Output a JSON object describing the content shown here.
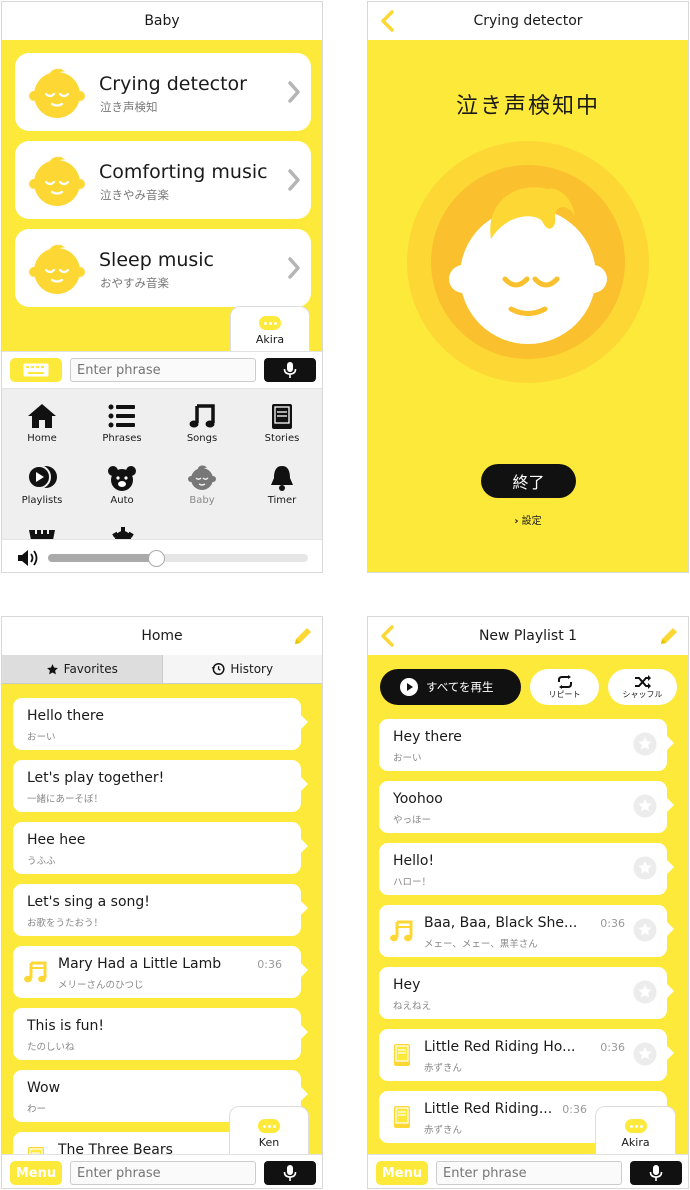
{
  "baby_screen": {
    "title": "Baby",
    "cards": [
      {
        "title": "Crying detector",
        "subtitle": "泣き声検知"
      },
      {
        "title": "Comforting music",
        "subtitle": "泣きやみ音楽"
      },
      {
        "title": "Sleep music",
        "subtitle": "おやすみ音楽"
      }
    ],
    "user_tab": "Akira",
    "phrase_placeholder": "Enter phrase",
    "menu": [
      {
        "label": "Home",
        "icon": "home-icon"
      },
      {
        "label": "Phrases",
        "icon": "list-icon"
      },
      {
        "label": "Songs",
        "icon": "music-note-icon"
      },
      {
        "label": "Stories",
        "icon": "book-icon"
      },
      {
        "label": "Playlists",
        "icon": "playlist-icon"
      },
      {
        "label": "Auto",
        "icon": "bear-icon"
      },
      {
        "label": "Baby",
        "icon": "baby-icon"
      },
      {
        "label": "Timer",
        "icon": "bell-icon"
      }
    ],
    "volume": 0.41
  },
  "crying_screen": {
    "title": "Crying detector",
    "status": "泣き声検知中",
    "end_button": "終了",
    "settings_link": "設定"
  },
  "home_screen": {
    "title": "Home",
    "tabs": [
      "Favorites",
      "History"
    ],
    "items": [
      {
        "main": "Hello there",
        "sub": "おーい"
      },
      {
        "main": "Let's play together!",
        "sub": "一緒にあーそぼ！"
      },
      {
        "main": "Hee hee",
        "sub": "うふふ"
      },
      {
        "main": "Let's sing a song!",
        "sub": "お歌をうたおう！"
      },
      {
        "main": "Mary Had a Little Lamb",
        "sub": "メリーさんのひつじ",
        "duration": "0:36"
      },
      {
        "main": "This is fun!",
        "sub": "たのしいね"
      },
      {
        "main": "Wow",
        "sub": "わー"
      },
      {
        "main": "The Three Bears",
        "sub": ""
      }
    ],
    "user_tab": "Ken",
    "menu_button": "Menu",
    "phrase_placeholder": "Enter phrase"
  },
  "playlist_screen": {
    "title": "New Playlist 1",
    "play_all": "すべてを再生",
    "repeat": "リピート",
    "shuffle": "シャッフル",
    "items": [
      {
        "main": "Hey there",
        "sub": "おーい"
      },
      {
        "main": "Yoohoo",
        "sub": "やっほー"
      },
      {
        "main": "Hello!",
        "sub": "ハロー！"
      },
      {
        "main": "Baa, Baa, Black She...",
        "sub": "メェー、メェー、黒羊さん",
        "duration": "0:36"
      },
      {
        "main": "Hey",
        "sub": "ねえねえ"
      },
      {
        "main": "Little Red Riding Ho...",
        "sub": "赤ずきん",
        "duration": "0:36"
      },
      {
        "main": "Little Red Riding...",
        "sub": "赤ずきん",
        "duration": "0:36"
      }
    ],
    "user_tab": "Akira",
    "menu_button": "Menu",
    "phrase_placeholder": "Enter phrase"
  },
  "colors": {
    "accent": "#fde93a",
    "dark": "#111111",
    "face": "#fdd835"
  }
}
